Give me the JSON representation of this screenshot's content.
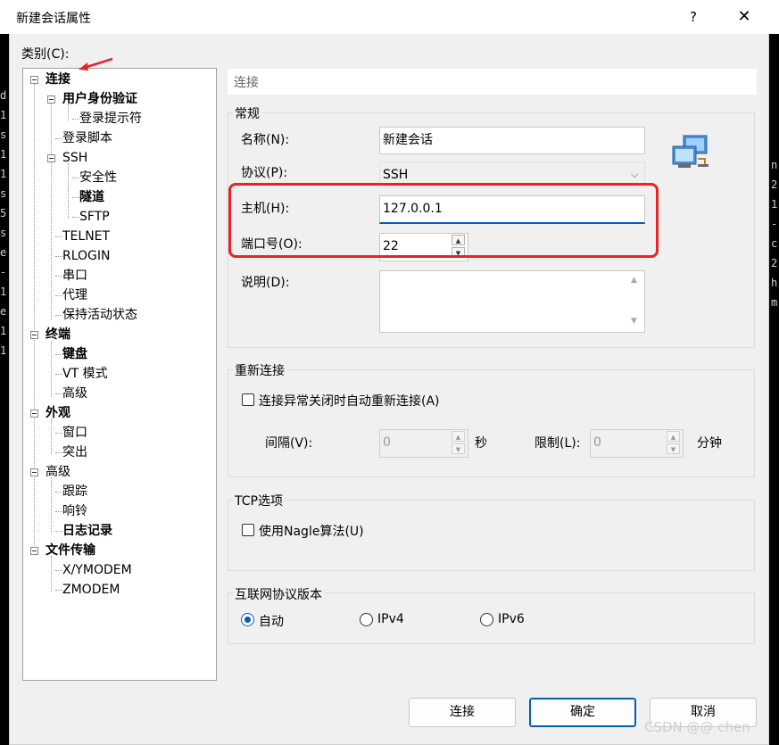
{
  "window": {
    "title": "新建会话属性",
    "help": "?",
    "close": "✕"
  },
  "category_label": "类别(C):",
  "tree": {
    "connection": "连接",
    "user_auth": "用户身份验证",
    "login_prompt": "登录提示符",
    "login_script": "登录脚本",
    "ssh": "SSH",
    "security": "安全性",
    "tunnel": "隧道",
    "sftp": "SFTP",
    "telnet": "TELNET",
    "rlogin": "RLOGIN",
    "serial": "串口",
    "proxy": "代理",
    "keepalive": "保持活动状态",
    "terminal": "终端",
    "keyboard": "键盘",
    "vt_mode": "VT 模式",
    "advanced": "高级",
    "appearance": "外观",
    "window": "窗口",
    "highlight": "突出",
    "advanced2": "高级",
    "trace": "跟踪",
    "bell": "响铃",
    "log": "日志记录",
    "file_transfer": "文件传输",
    "xymodem": "X/YMODEM",
    "zmodem": "ZMODEM"
  },
  "section_title": "连接",
  "general": {
    "label": "常规",
    "name_label": "名称(N):",
    "name_value": "新建会话",
    "protocol_label": "协议(P):",
    "protocol_value": "SSH",
    "host_label": "主机(H):",
    "host_value": "127.0.0.1",
    "port_label": "端口号(O):",
    "port_value": "22",
    "desc_label": "说明(D):",
    "desc_value": ""
  },
  "reconnect": {
    "label": "重新连接",
    "checkbox_label": "连接异常关闭时自动重新连接(A)",
    "checked": false,
    "interval_label": "间隔(V):",
    "interval_value": "0",
    "interval_unit": "秒",
    "limit_label": "限制(L):",
    "limit_value": "0",
    "limit_unit": "分钟"
  },
  "tcp": {
    "label": "TCP选项",
    "nagle_label": "使用Nagle算法(U)",
    "checked": false
  },
  "ip_version": {
    "label": "互联网协议版本",
    "options": [
      "自动",
      "IPv4",
      "IPv6"
    ],
    "selected": "自动"
  },
  "buttons": {
    "connect": "连接",
    "ok": "确定",
    "cancel": "取消"
  },
  "watermark": "CSDN @@ chen",
  "background_chars": [
    "d",
    "1",
    "s",
    "1",
    "1",
    "s",
    "5",
    "s",
    "e",
    "-",
    "1",
    "e",
    "1",
    "1"
  ],
  "background_chars_right": [
    "n",
    "2",
    "1",
    "-",
    "c",
    "2",
    "h",
    "m"
  ],
  "colors": {
    "accent": "#005fb8",
    "annotation": "#e8232a"
  },
  "icons": {
    "session": "network-computers-icon",
    "annotation_arrow": "red-arrow-icon"
  }
}
